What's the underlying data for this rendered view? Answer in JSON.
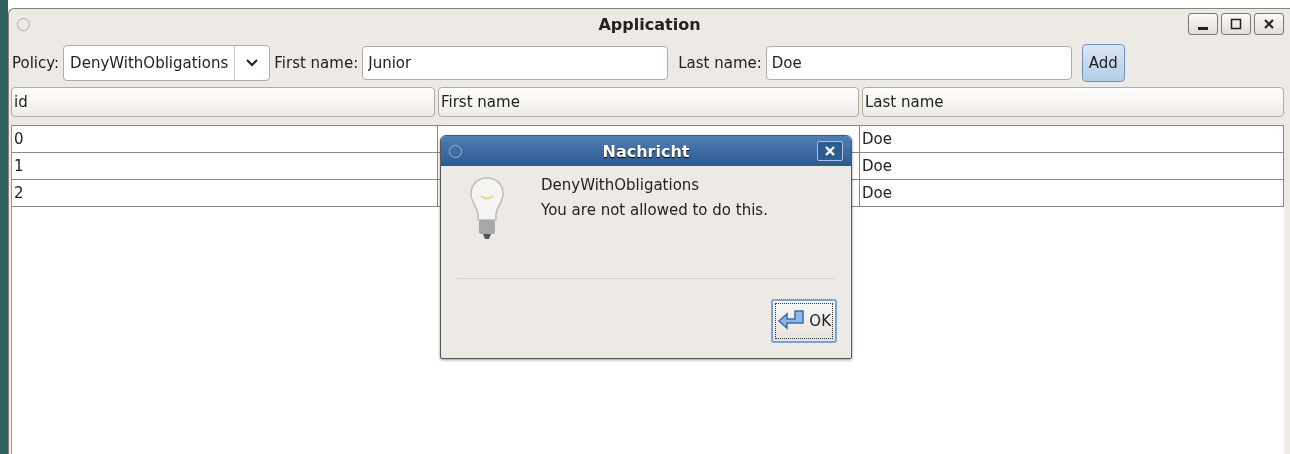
{
  "window": {
    "title": "Application"
  },
  "toolbar": {
    "policy_label": "Policy:",
    "policy_value": "DenyWithObligations",
    "first_name_label": "First name:",
    "first_name_value": "Junior",
    "last_name_label": "Last name:",
    "last_name_value": "Doe",
    "add_button": "Add"
  },
  "table": {
    "columns": [
      "id",
      "First name",
      "Last name"
    ],
    "rows": [
      {
        "id": "0",
        "last_name": "Doe"
      },
      {
        "id": "1",
        "last_name": "Doe"
      },
      {
        "id": "2",
        "last_name": "Doe"
      }
    ]
  },
  "dialog": {
    "title": "Nachricht",
    "lines": [
      "DenyWithObligations",
      "You are not allowed to do this."
    ],
    "button": "OK"
  }
}
